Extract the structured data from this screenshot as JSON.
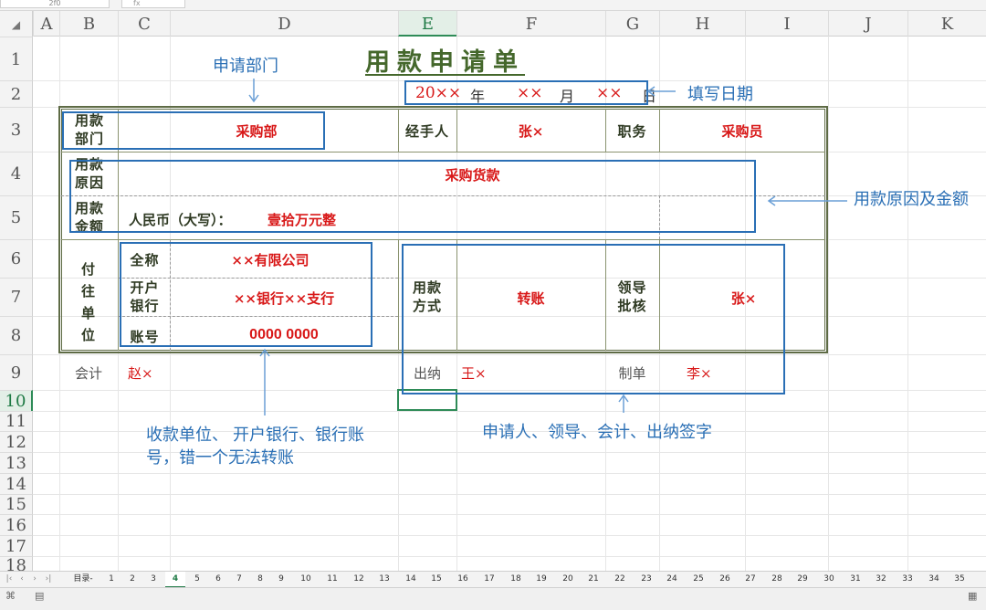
{
  "toolbar": {
    "cell_ref": "2f0",
    "formula_icon": "fx"
  },
  "columns": [
    "A",
    "B",
    "C",
    "D",
    "E",
    "F",
    "G",
    "H",
    "I",
    "J",
    "K"
  ],
  "selected_column": "E",
  "rows": [
    "1",
    "2",
    "3",
    "4",
    "5",
    "6",
    "7",
    "8",
    "9",
    "10",
    "11",
    "12",
    "13",
    "14",
    "15",
    "16",
    "17",
    "18"
  ],
  "selected_row": "10",
  "form": {
    "title": "用款申请单",
    "date": {
      "year_prefix": "20××",
      "year": "年",
      "month_val": "××",
      "month": "月",
      "day_val": "××",
      "day": "日"
    },
    "row3": {
      "dept_label_1": "用款",
      "dept_label_2": "部门",
      "dept_value": "采购部",
      "handler_label": "经手人",
      "handler_value": "张×",
      "title_label": "职务",
      "title_value": "采购员"
    },
    "row4": {
      "reason_label_1": "用款",
      "reason_label_2": "原因",
      "reason_value": "采购货款"
    },
    "row5": {
      "amount_label_1": "用款",
      "amount_label_2": "金额",
      "amount_prefix": "人民币（大写）：",
      "amount_value": "壹拾万元整"
    },
    "payee": {
      "label_1": "付",
      "label_2": "往",
      "label_3": "单",
      "label_4": "位",
      "name_label": "全称",
      "name_value": "××有限公司",
      "bank_label_1": "开户",
      "bank_label_2": "银行",
      "bank_value": "××银行××支行",
      "account_label": "账号",
      "account_value": "0000 0000"
    },
    "method": {
      "label_1": "用款",
      "label_2": "方式",
      "value": "转账",
      "approve_label_1": "领导",
      "approve_label_2": "批核",
      "approve_value": "张×"
    },
    "row9": {
      "accountant_label": "会计",
      "accountant_value": "赵×",
      "cashier_label": "出纳",
      "cashier_value": "王×",
      "maker_label": "制单",
      "maker_value": "李×"
    }
  },
  "annotations": {
    "dept": "申请部门",
    "date": "填写日期",
    "reason": "用款原因及金额",
    "payee_1": "收款单位、 开户银行、银行账",
    "payee_2": "号，错一个无法转账",
    "sign": "申请人、领导、会计、出纳签字"
  },
  "sheet_tabs": [
    "目录-",
    "1",
    "2",
    "3",
    "4",
    "5",
    "6",
    "7",
    "8",
    "9",
    "10",
    "11",
    "12",
    "13",
    "14",
    "15",
    "16",
    "17",
    "18",
    "19",
    "20",
    "21",
    "22",
    "23",
    "24",
    "25",
    "26",
    "27",
    "28",
    "29",
    "30",
    "31",
    "32",
    "33",
    "34",
    "35"
  ],
  "active_tab": "4",
  "colors": {
    "accent": "#1f7a45",
    "annotation": "#2a6fb5",
    "value_red": "#d81818",
    "form_border": "#5e6b45"
  }
}
